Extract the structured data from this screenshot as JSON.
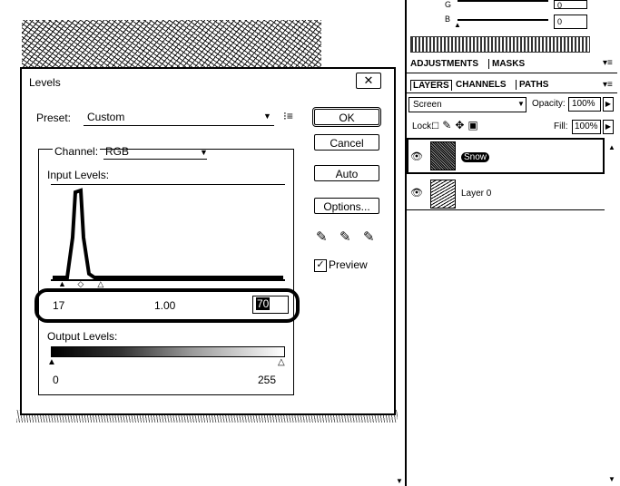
{
  "dialog": {
    "title": "Levels",
    "close_glyph": "✕",
    "preset_label": "Preset:",
    "preset_value": "Custom",
    "channel_label": "Channel:",
    "channel_value": "RGB",
    "input_levels_label": "Input Levels:",
    "input_black": "17",
    "input_gamma": "1.00",
    "input_white": "70",
    "output_levels_label": "Output Levels:",
    "output_black": "0",
    "output_white": "255",
    "buttons": {
      "ok": "OK",
      "cancel": "Cancel",
      "auto": "Auto",
      "options": "Options..."
    },
    "preview_label": "Preview",
    "preview_checked": true
  },
  "panel": {
    "g_label": "G",
    "b_label": "B",
    "g_value": "0",
    "b_value": "0",
    "tabs_top": [
      "ADJUSTMENTS",
      "MASKS"
    ],
    "tabs_layers": [
      "LAYERS",
      "CHANNELS",
      "PATHS"
    ],
    "blend_mode": "Screen",
    "opacity_label": "Opacity:",
    "opacity_value": "100%",
    "lock_label": "Lock:",
    "fill_label": "Fill:",
    "fill_value": "100%",
    "layers": [
      {
        "name": "Snow",
        "selected": true
      },
      {
        "name": "Layer 0",
        "selected": false
      }
    ]
  },
  "icons": [
    "close-icon",
    "preset-menu-icon",
    "black-eyedropper-icon",
    "gray-eyedropper-icon",
    "white-eyedropper-icon",
    "eye-icon",
    "lock-transparent-icon",
    "lock-brush-icon",
    "lock-move-icon",
    "lock-all-icon",
    "panel-menu-icon"
  ]
}
